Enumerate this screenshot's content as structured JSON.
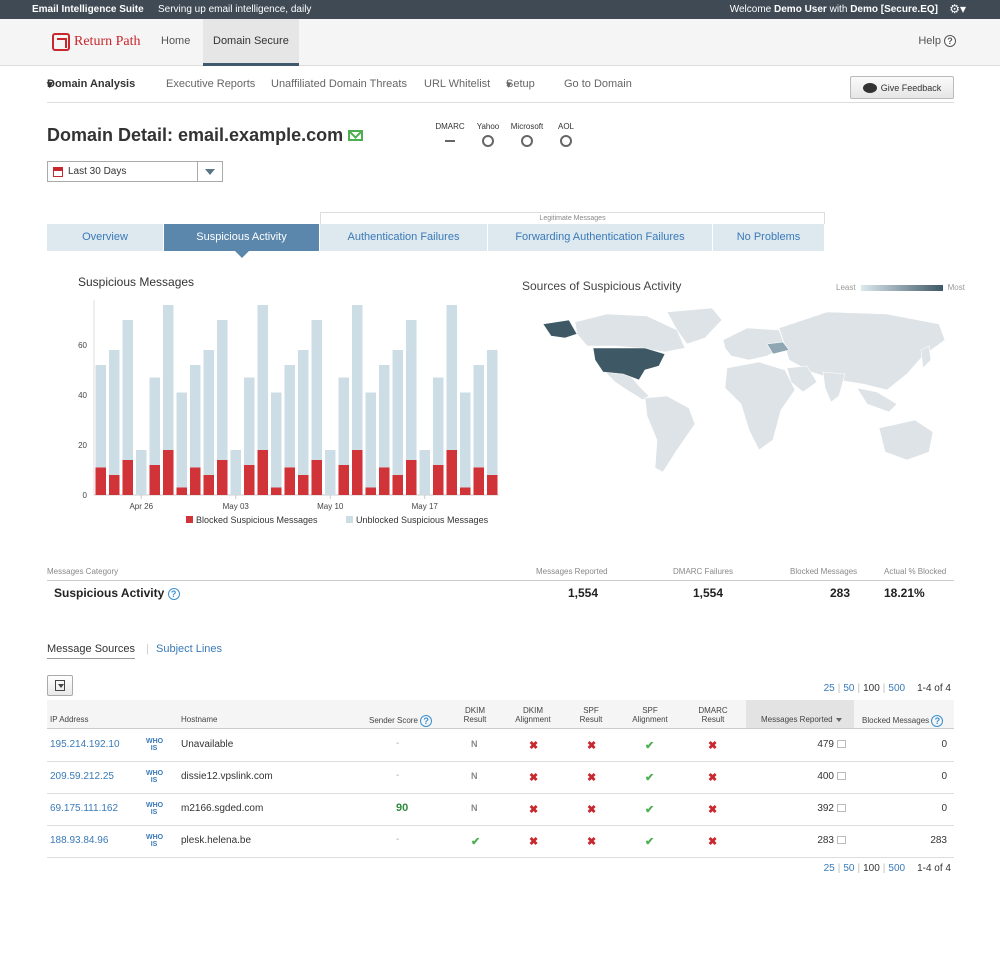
{
  "topbar": {
    "suite": "Email Intelligence Suite",
    "tagline": "Serving up email intelligence, daily",
    "welcome_prefix": "Welcome",
    "user": "Demo User",
    "with": "with",
    "account": "Demo [Secure.EQ]"
  },
  "header": {
    "logo": "Return Path",
    "tabs": [
      "Home",
      "Domain Secure"
    ],
    "help": "Help"
  },
  "subnav": {
    "items": [
      "Domain Analysis",
      "Executive Reports",
      "Unaffiliated Domain Threats",
      "URL Whitelist",
      "Setup",
      "Go to Domain"
    ],
    "feedback": "Give Feedback"
  },
  "page": {
    "title": "Domain Detail: email.example.com",
    "providers": [
      "DMARC",
      "Yahoo",
      "Microsoft",
      "AOL"
    ],
    "date_range": "Last 30 Days"
  },
  "tabs": {
    "group_label": "Legitimate Messages",
    "items": [
      "Overview",
      "Suspicious Activity",
      "Authentication Failures",
      "Forwarding Authentication Failures",
      "No Problems"
    ]
  },
  "chart_data": {
    "type": "bar",
    "title": "Suspicious Messages",
    "stacked": true,
    "x_ticks": [
      "Apr 26",
      "May 03",
      "May 10",
      "May 17"
    ],
    "y_ticks": [
      0,
      20,
      40,
      60
    ],
    "ylim": [
      0,
      78
    ],
    "legend_position": "bottom",
    "series": [
      {
        "name": "Blocked Suspicious Messages",
        "color": "#d13438",
        "values": [
          11,
          8,
          14,
          0,
          12,
          18,
          3,
          11,
          8,
          14,
          0,
          12,
          18,
          3,
          11,
          8,
          14,
          0,
          12,
          18,
          3,
          11,
          8,
          14,
          0,
          12,
          18,
          3,
          11,
          8
        ]
      },
      {
        "name": "Unblocked Suspicious Messages",
        "color": "#ccdde5",
        "values": [
          41,
          50,
          56,
          18,
          35,
          58,
          38,
          41,
          50,
          56,
          18,
          35,
          58,
          38,
          41,
          50,
          56,
          18,
          35,
          58,
          38,
          41,
          50,
          56,
          18,
          35,
          58,
          38,
          41,
          50
        ]
      }
    ]
  },
  "map": {
    "title": "Sources of Suspicious Activity",
    "legend_least": "Least",
    "legend_most": "Most"
  },
  "summary": {
    "headers": [
      "Messages Category",
      "Messages Reported",
      "DMARC Failures",
      "Blocked Messages",
      "Actual % Blocked"
    ],
    "category": "Suspicious Activity",
    "reported": "1,554",
    "dmarc_failures": "1,554",
    "blocked": "283",
    "pct_blocked": "18.21%"
  },
  "sources": {
    "tabs": [
      "Message Sources",
      "Subject Lines"
    ],
    "pager": {
      "sizes": [
        "25",
        "50",
        "100",
        "500"
      ],
      "current": "100",
      "count": "1-4 of 4"
    },
    "headers": {
      "ip": "IP Address",
      "hostname": "Hostname",
      "sender_score": "Sender Score",
      "dkim_result": [
        "DKIM",
        "Result"
      ],
      "dkim_alignment": [
        "DKIM",
        "Alignment"
      ],
      "spf_result": [
        "SPF",
        "Result"
      ],
      "spf_alignment": [
        "SPF",
        "Alignment"
      ],
      "dmarc_result": [
        "DMARC",
        "Result"
      ],
      "reported": "Messages Reported",
      "blocked": "Blocked Messages"
    },
    "whois": [
      "WHO",
      "IS"
    ],
    "rows": [
      {
        "ip": "195.214.192.10",
        "host": "Unavailable",
        "score": "-",
        "dkim": "N",
        "dkim_align": "✖",
        "spf": "✖",
        "spf_align": "✔",
        "dmarc": "✖",
        "reported": "479",
        "blocked": "0"
      },
      {
        "ip": "209.59.212.25",
        "host": "dissie12.vpslink.com",
        "score": "-",
        "dkim": "N",
        "dkim_align": "✖",
        "spf": "✖",
        "spf_align": "✔",
        "dmarc": "✖",
        "reported": "400",
        "blocked": "0"
      },
      {
        "ip": "69.175.111.162",
        "host": "m2166.sgded.com",
        "score": "90",
        "dkim": "N",
        "dkim_align": "✖",
        "spf": "✖",
        "spf_align": "✔",
        "dmarc": "✖",
        "reported": "392",
        "blocked": "0"
      },
      {
        "ip": "188.93.84.96",
        "host": "plesk.helena.be",
        "score": "-",
        "dkim": "✔",
        "dkim_align": "✖",
        "spf": "✖",
        "spf_align": "✔",
        "dmarc": "✖",
        "reported": "283",
        "blocked": "283"
      }
    ]
  }
}
